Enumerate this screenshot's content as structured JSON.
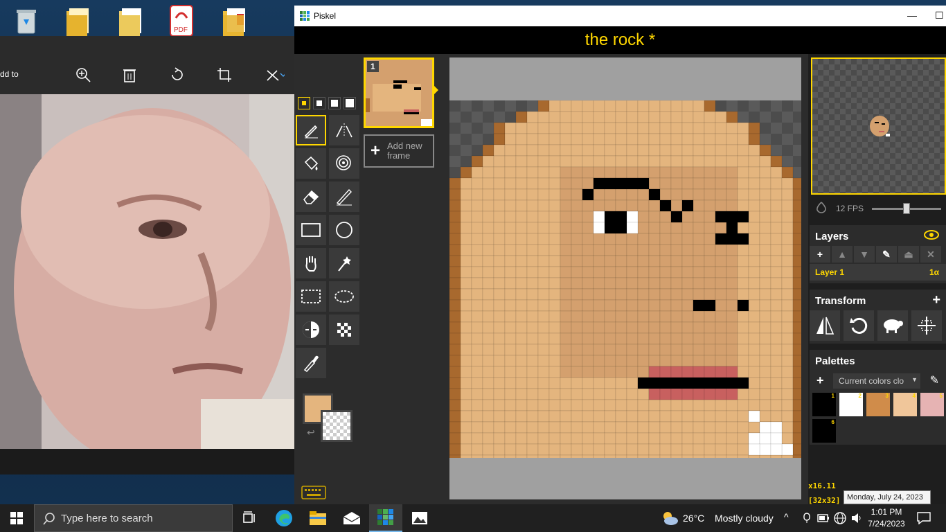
{
  "photos": {
    "toolbar_partial_label": "dd to"
  },
  "piskel": {
    "window_title": "Piskel",
    "document_title": "the rock *",
    "frames": [
      {
        "number": "1"
      }
    ],
    "add_frame_label": "Add new frame",
    "fps_label": "12 FPS",
    "fps_value": 12,
    "layers": {
      "title": "Layers",
      "items": [
        {
          "name": "Layer 1",
          "opacity": "1α"
        }
      ]
    },
    "transform": {
      "title": "Transform"
    },
    "palettes": {
      "title": "Palettes",
      "selected": "Current colors clo",
      "swatches": [
        {
          "index": "1",
          "color": "#000000"
        },
        {
          "index": "2",
          "color": "#ffffff"
        },
        {
          "index": "3",
          "color": "#d08c4a"
        },
        {
          "index": "4",
          "color": "#f0c69a"
        },
        {
          "index": "5",
          "color": "#e6b3b3"
        },
        {
          "index": "6",
          "color": "#000000"
        }
      ]
    },
    "primary_color": "#e4b57e",
    "zoom_label": "x16.11",
    "size_label": "[32x32]"
  },
  "tooltip": "Monday, July 24, 2023",
  "taskbar": {
    "search_placeholder": "Type here to search",
    "weather": {
      "temp": "26°C",
      "desc": "Mostly cloudy"
    },
    "time": "1:01 PM",
    "date": "7/24/2023"
  },
  "colors": {
    "accent": "#ffd700",
    "skin_light": "#e4b57e",
    "skin_mid": "#d4a06e",
    "skin_dark": "#a8692e",
    "lip": "#c8605f"
  }
}
